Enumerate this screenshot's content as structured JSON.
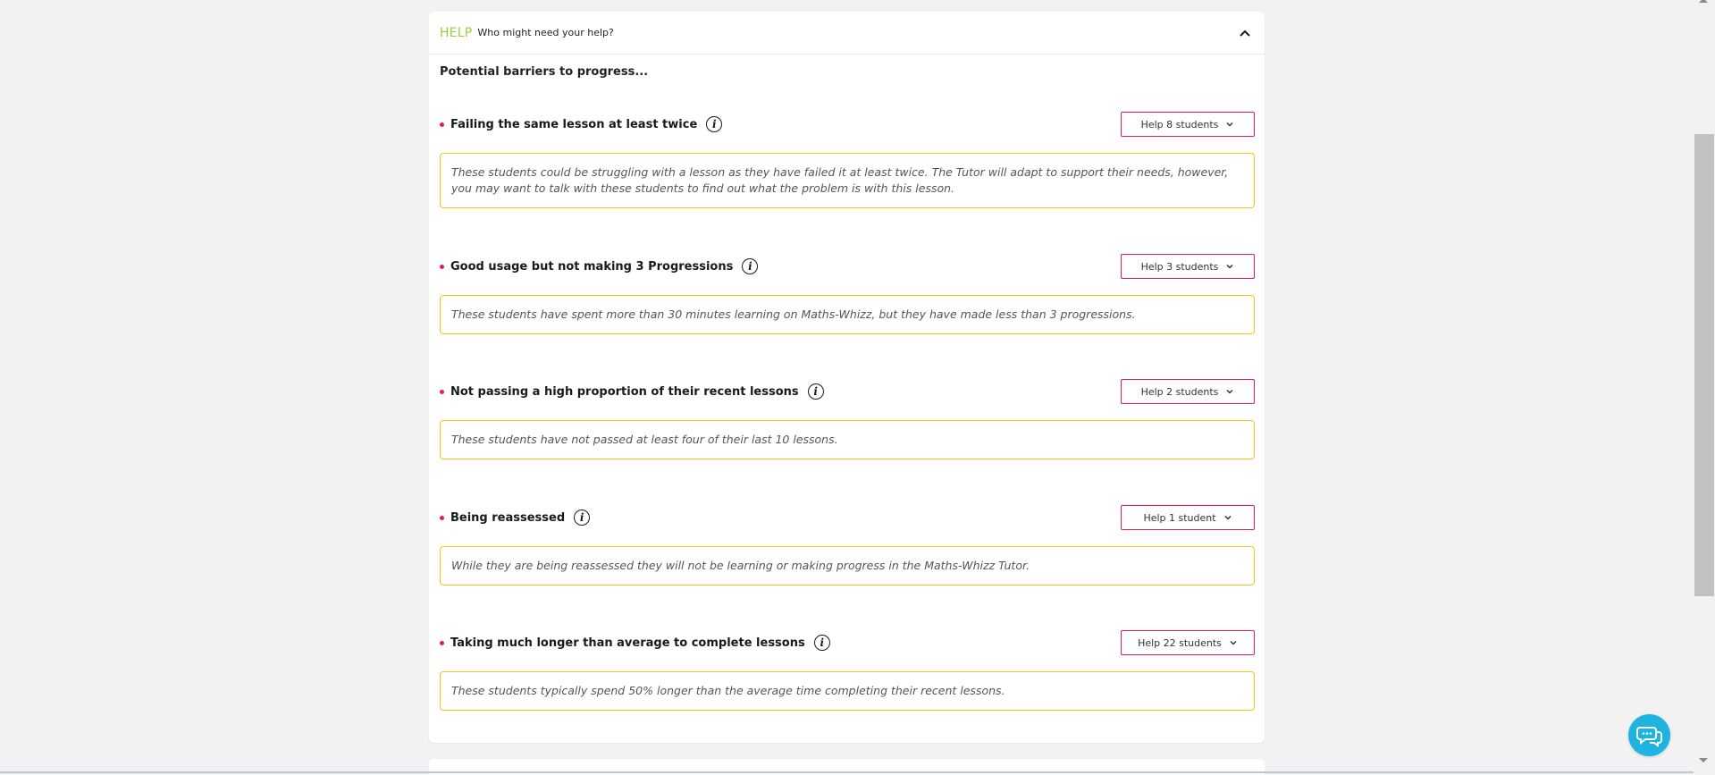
{
  "header": {
    "tag": "HELP",
    "title": "Who might need your help?"
  },
  "intro": "Potential barriers to progress...",
  "barriers": [
    {
      "title": "Failing the same lesson at least twice",
      "button_label": "Help 8 students",
      "description": "These students could be struggling with a lesson as they have failed it at least twice. The Tutor will adapt to support their needs, however, you may want to talk with these students to find out what the problem is with this lesson."
    },
    {
      "title": "Good usage but not making 3 Progressions",
      "button_label": "Help 3 students",
      "description": "These students have spent more than 30 minutes learning on Maths-Whizz, but they have made less than 3 progressions."
    },
    {
      "title": "Not passing a high proportion of their recent lessons",
      "button_label": "Help 2 students",
      "description": "These students have not passed at least four of their last 10 lessons."
    },
    {
      "title": "Being reassessed",
      "button_label": "Help 1 student",
      "description": "While they are being reassessed they will not be learning or making progress in the Maths-Whizz Tutor."
    },
    {
      "title": "Taking much longer than average to complete lessons",
      "button_label": "Help 22 students",
      "description": "These students typically spend 50% longer than the average time completing their recent lessons."
    }
  ],
  "info_icon_glyph": "i",
  "colors": {
    "accent_pink": "#e6195a",
    "accent_green": "#9ccc3c",
    "desc_border": "#f5c518",
    "chat_blue": "#1fb4e0"
  }
}
